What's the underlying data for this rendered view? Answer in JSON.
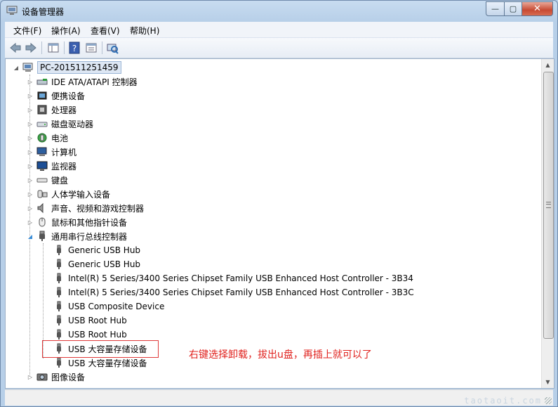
{
  "window": {
    "title": "设备管理器",
    "buttons": {
      "minimize": "—",
      "maximize": "▢",
      "close": "✕"
    }
  },
  "menubar": [
    "文件(F)",
    "操作(A)",
    "查看(V)",
    "帮助(H)"
  ],
  "tree": {
    "root": "PC-201511251459",
    "categories": [
      {
        "label": "IDE ATA/ATAPI 控制器",
        "icon": "ide-controller-icon"
      },
      {
        "label": "便携设备",
        "icon": "portable-device-icon"
      },
      {
        "label": "处理器",
        "icon": "processor-icon"
      },
      {
        "label": "磁盘驱动器",
        "icon": "disk-drive-icon"
      },
      {
        "label": "电池",
        "icon": "battery-icon"
      },
      {
        "label": "计算机",
        "icon": "computer-icon"
      },
      {
        "label": "监视器",
        "icon": "monitor-icon"
      },
      {
        "label": "键盘",
        "icon": "keyboard-icon"
      },
      {
        "label": "人体学输入设备",
        "icon": "hid-icon"
      },
      {
        "label": "声音、视频和游戏控制器",
        "icon": "sound-icon"
      },
      {
        "label": "鼠标和其他指针设备",
        "icon": "mouse-icon"
      },
      {
        "label": "通用串行总线控制器",
        "icon": "usb-icon"
      }
    ],
    "usb_children": [
      "Generic USB Hub",
      "Generic USB Hub",
      "Intel(R) 5 Series/3400 Series Chipset Family USB Enhanced Host Controller - 3B34",
      "Intel(R) 5 Series/3400 Series Chipset Family USB Enhanced Host Controller - 3B3C",
      "USB Composite Device",
      "USB Root Hub",
      "USB Root Hub",
      "USB 大容量存储设备",
      "USB 大容量存储设备"
    ],
    "after_usb": {
      "label": "图像设备",
      "icon": "imaging-device-icon"
    }
  },
  "annotation": "右键选择卸载，拔出u盘，再插上就可以了",
  "watermark": "taotaoit.com",
  "colors": {
    "annotation": "#e0211d",
    "highlight": "#e03a3a",
    "title_bg": "#c8dcf0"
  }
}
